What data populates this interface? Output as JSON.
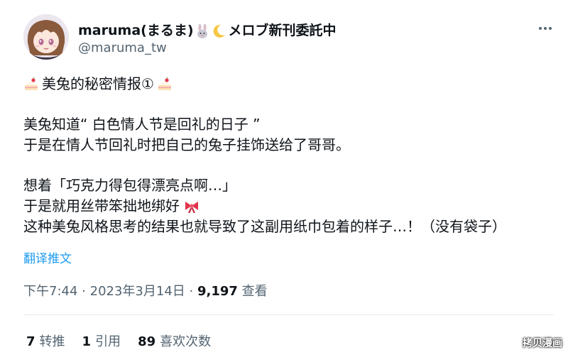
{
  "author": {
    "display_name": "maruma(まるま)",
    "display_name_suffix": "メロブ新刊委託中",
    "handle": "@maruma_tw"
  },
  "tweet": {
    "line1": "美兔的秘密情报①",
    "line2": "美兔知道“ 白色情人节是回礼的日子 ”",
    "line3": "于是在情人节回礼时把自己的兔子挂饰送给了哥哥。",
    "line4": "想着「巧克力得包得漂亮点啊…」",
    "line5": "于是就用丝带笨拙地绑好",
    "line6": "这种美兔风格思考的结果也就导致了这副用纸巾包着的样子…！（没有袋子）"
  },
  "translate_label": "翻译推文",
  "meta": {
    "time": "下午7:44",
    "separator": "·",
    "date": "2023年3月14日",
    "views_count": "9,197",
    "views_label": "查看"
  },
  "stats": {
    "retweets_count": "7",
    "retweets_label": "转推",
    "quotes_count": "1",
    "quotes_label": "引用",
    "likes_count": "89",
    "likes_label": "喜欢次数"
  },
  "icons": {
    "more": "more-horizontal-icon",
    "rabbit": "rabbit-emoji-icon",
    "moon": "crescent-moon-emoji-icon",
    "cake": "shortcake-emoji-icon",
    "ribbon": "ribbon-emoji-icon"
  },
  "watermark_text": "拷贝漫画"
}
